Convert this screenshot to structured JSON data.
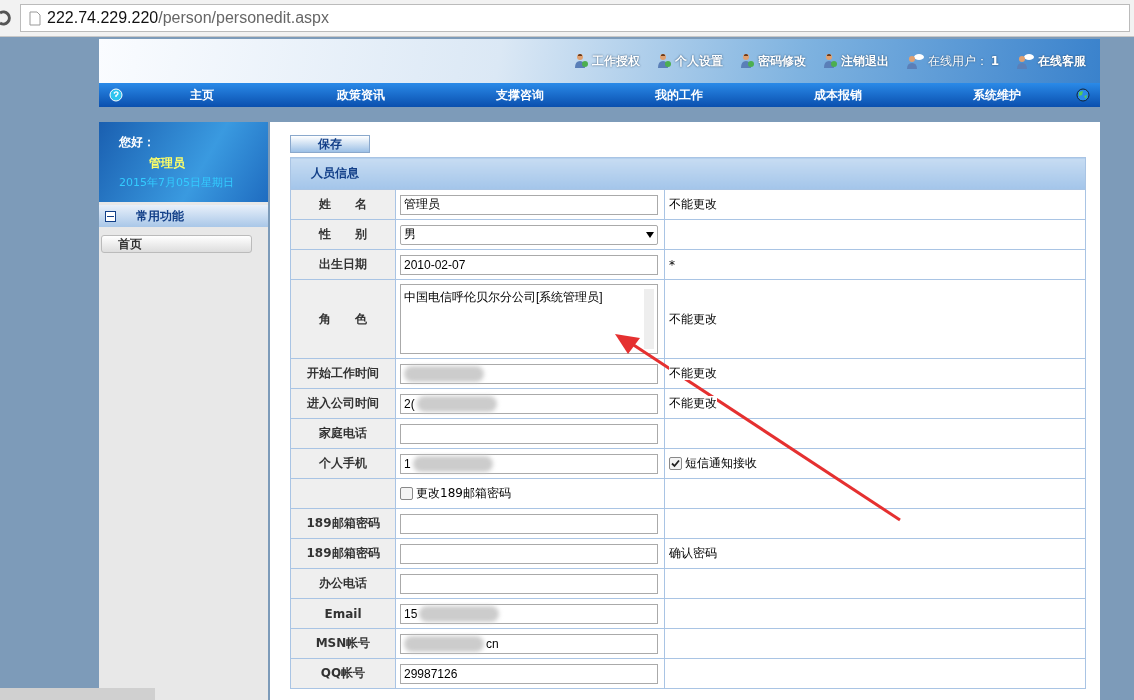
{
  "browser": {
    "url_host": "222.74.229.220",
    "url_path": "/person/personedit.aspx"
  },
  "header_links": [
    {
      "label": "工作授权",
      "kind": "link"
    },
    {
      "label": "个人设置",
      "kind": "link"
    },
    {
      "label": "密码修改",
      "kind": "link"
    },
    {
      "label": "注销退出",
      "kind": "link"
    },
    {
      "label": "在线用户：",
      "count": "1",
      "kind": "status"
    },
    {
      "label": "在线客服",
      "kind": "service"
    }
  ],
  "nav": [
    "主页",
    "政策资讯",
    "支撑咨询",
    "我的工作",
    "成本报销",
    "系统维护"
  ],
  "sidebar": {
    "greeting": "您好：",
    "user": "管理员",
    "date": "2015年7月05日星期日",
    "section": "常用功能",
    "section_expanded": true,
    "items": [
      "首页"
    ]
  },
  "save_button": "保存",
  "form": {
    "title": "人员信息",
    "rows": [
      {
        "label": "姓　　名",
        "kind": "input",
        "value": "管理员",
        "note": "不能更改"
      },
      {
        "label": "性　　别",
        "kind": "select",
        "value": "男"
      },
      {
        "label": "出生日期",
        "kind": "input",
        "value": "2010-02-07",
        "note": "*"
      },
      {
        "label": "角　　色",
        "kind": "textarea",
        "value": "中国电信呼伦贝尔分公司[系统管理员]",
        "note": "不能更改"
      },
      {
        "label": "开始工作时间",
        "kind": "input",
        "redacted": true,
        "note": "不能更改"
      },
      {
        "label": "进入公司时间",
        "kind": "input",
        "value": "2(",
        "redacted": true,
        "note": "不能更改"
      },
      {
        "label": "家庭电话",
        "kind": "input"
      },
      {
        "label": "个人手机",
        "kind": "input",
        "value": "1",
        "redacted": true,
        "note_check": {
          "label": "短信通知接收",
          "checked": true
        }
      },
      {
        "kind": "checkbox",
        "check": {
          "label": "更改189邮箱密码",
          "checked": false
        }
      },
      {
        "label": "189邮箱密码",
        "kind": "input"
      },
      {
        "label": "189邮箱密码",
        "kind": "input",
        "note": "确认密码"
      },
      {
        "label": "办公电话",
        "kind": "input"
      },
      {
        "label": "Email",
        "kind": "input",
        "value": "15",
        "redacted": true
      },
      {
        "label": "MSN帐号",
        "kind": "input",
        "value": "cn",
        "redacted": true,
        "redact_before": true
      },
      {
        "label": "QQ帐号",
        "kind": "input",
        "value": "29987126"
      }
    ]
  }
}
